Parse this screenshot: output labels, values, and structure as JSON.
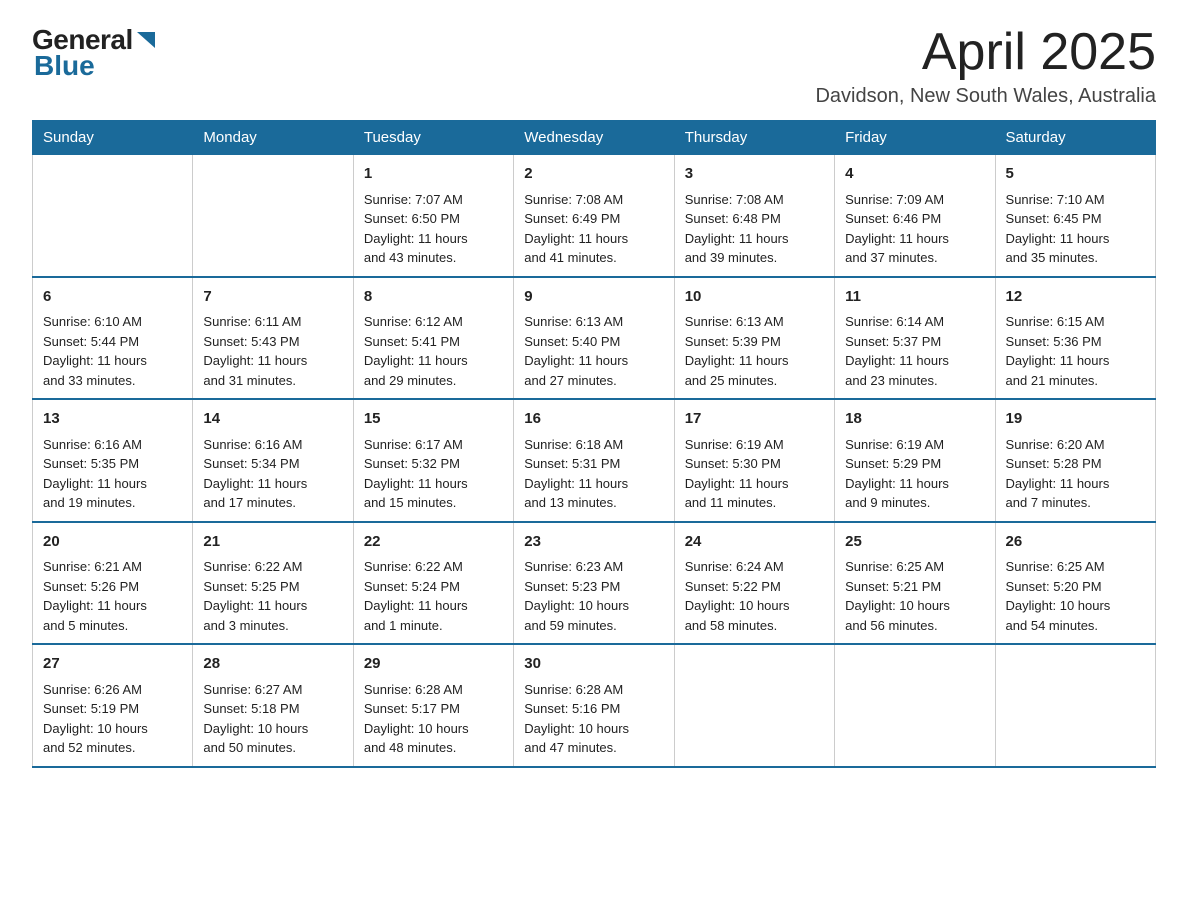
{
  "logo": {
    "general": "General",
    "blue": "Blue"
  },
  "title": "April 2025",
  "subtitle": "Davidson, New South Wales, Australia",
  "weekdays": [
    "Sunday",
    "Monday",
    "Tuesday",
    "Wednesday",
    "Thursday",
    "Friday",
    "Saturday"
  ],
  "weeks": [
    [
      {
        "day": "",
        "info": ""
      },
      {
        "day": "",
        "info": ""
      },
      {
        "day": "1",
        "info": "Sunrise: 7:07 AM\nSunset: 6:50 PM\nDaylight: 11 hours\nand 43 minutes."
      },
      {
        "day": "2",
        "info": "Sunrise: 7:08 AM\nSunset: 6:49 PM\nDaylight: 11 hours\nand 41 minutes."
      },
      {
        "day": "3",
        "info": "Sunrise: 7:08 AM\nSunset: 6:48 PM\nDaylight: 11 hours\nand 39 minutes."
      },
      {
        "day": "4",
        "info": "Sunrise: 7:09 AM\nSunset: 6:46 PM\nDaylight: 11 hours\nand 37 minutes."
      },
      {
        "day": "5",
        "info": "Sunrise: 7:10 AM\nSunset: 6:45 PM\nDaylight: 11 hours\nand 35 minutes."
      }
    ],
    [
      {
        "day": "6",
        "info": "Sunrise: 6:10 AM\nSunset: 5:44 PM\nDaylight: 11 hours\nand 33 minutes."
      },
      {
        "day": "7",
        "info": "Sunrise: 6:11 AM\nSunset: 5:43 PM\nDaylight: 11 hours\nand 31 minutes."
      },
      {
        "day": "8",
        "info": "Sunrise: 6:12 AM\nSunset: 5:41 PM\nDaylight: 11 hours\nand 29 minutes."
      },
      {
        "day": "9",
        "info": "Sunrise: 6:13 AM\nSunset: 5:40 PM\nDaylight: 11 hours\nand 27 minutes."
      },
      {
        "day": "10",
        "info": "Sunrise: 6:13 AM\nSunset: 5:39 PM\nDaylight: 11 hours\nand 25 minutes."
      },
      {
        "day": "11",
        "info": "Sunrise: 6:14 AM\nSunset: 5:37 PM\nDaylight: 11 hours\nand 23 minutes."
      },
      {
        "day": "12",
        "info": "Sunrise: 6:15 AM\nSunset: 5:36 PM\nDaylight: 11 hours\nand 21 minutes."
      }
    ],
    [
      {
        "day": "13",
        "info": "Sunrise: 6:16 AM\nSunset: 5:35 PM\nDaylight: 11 hours\nand 19 minutes."
      },
      {
        "day": "14",
        "info": "Sunrise: 6:16 AM\nSunset: 5:34 PM\nDaylight: 11 hours\nand 17 minutes."
      },
      {
        "day": "15",
        "info": "Sunrise: 6:17 AM\nSunset: 5:32 PM\nDaylight: 11 hours\nand 15 minutes."
      },
      {
        "day": "16",
        "info": "Sunrise: 6:18 AM\nSunset: 5:31 PM\nDaylight: 11 hours\nand 13 minutes."
      },
      {
        "day": "17",
        "info": "Sunrise: 6:19 AM\nSunset: 5:30 PM\nDaylight: 11 hours\nand 11 minutes."
      },
      {
        "day": "18",
        "info": "Sunrise: 6:19 AM\nSunset: 5:29 PM\nDaylight: 11 hours\nand 9 minutes."
      },
      {
        "day": "19",
        "info": "Sunrise: 6:20 AM\nSunset: 5:28 PM\nDaylight: 11 hours\nand 7 minutes."
      }
    ],
    [
      {
        "day": "20",
        "info": "Sunrise: 6:21 AM\nSunset: 5:26 PM\nDaylight: 11 hours\nand 5 minutes."
      },
      {
        "day": "21",
        "info": "Sunrise: 6:22 AM\nSunset: 5:25 PM\nDaylight: 11 hours\nand 3 minutes."
      },
      {
        "day": "22",
        "info": "Sunrise: 6:22 AM\nSunset: 5:24 PM\nDaylight: 11 hours\nand 1 minute."
      },
      {
        "day": "23",
        "info": "Sunrise: 6:23 AM\nSunset: 5:23 PM\nDaylight: 10 hours\nand 59 minutes."
      },
      {
        "day": "24",
        "info": "Sunrise: 6:24 AM\nSunset: 5:22 PM\nDaylight: 10 hours\nand 58 minutes."
      },
      {
        "day": "25",
        "info": "Sunrise: 6:25 AM\nSunset: 5:21 PM\nDaylight: 10 hours\nand 56 minutes."
      },
      {
        "day": "26",
        "info": "Sunrise: 6:25 AM\nSunset: 5:20 PM\nDaylight: 10 hours\nand 54 minutes."
      }
    ],
    [
      {
        "day": "27",
        "info": "Sunrise: 6:26 AM\nSunset: 5:19 PM\nDaylight: 10 hours\nand 52 minutes."
      },
      {
        "day": "28",
        "info": "Sunrise: 6:27 AM\nSunset: 5:18 PM\nDaylight: 10 hours\nand 50 minutes."
      },
      {
        "day": "29",
        "info": "Sunrise: 6:28 AM\nSunset: 5:17 PM\nDaylight: 10 hours\nand 48 minutes."
      },
      {
        "day": "30",
        "info": "Sunrise: 6:28 AM\nSunset: 5:16 PM\nDaylight: 10 hours\nand 47 minutes."
      },
      {
        "day": "",
        "info": ""
      },
      {
        "day": "",
        "info": ""
      },
      {
        "day": "",
        "info": ""
      }
    ]
  ]
}
